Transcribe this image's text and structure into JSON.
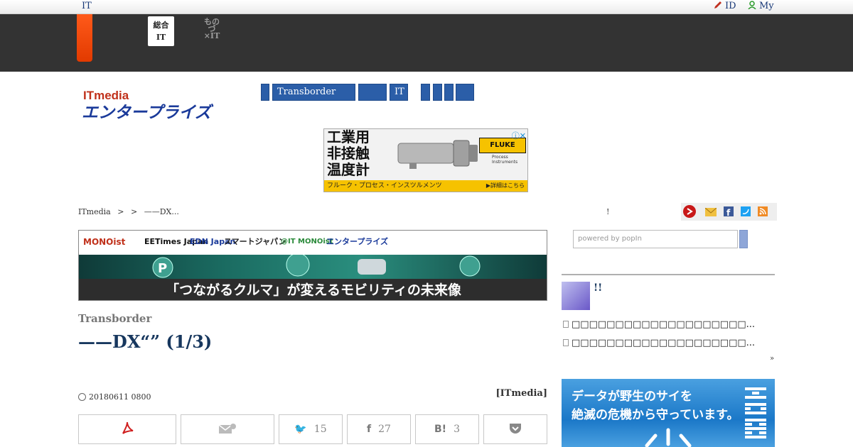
{
  "topbar": {
    "brand": "IT",
    "id_link": "ID",
    "my_link": "My"
  },
  "site_tabs": [
    {
      "line1": "総合",
      "line2": "IT"
    },
    {
      "line1": "ものづ",
      "line2": "×IT"
    }
  ],
  "logo": {
    "top": "ITmedia",
    "bottom": "エンタープライズ"
  },
  "nav": [
    "",
    "Transborder",
    "",
    "IT",
    "",
    "",
    "",
    ""
  ],
  "ad_top": {
    "heading_lines": [
      "工業用",
      "非接触",
      "温度計"
    ],
    "brand": "FLUKE",
    "brand_sub": [
      "Process",
      "Instruments"
    ],
    "strip": "フルーク・プロセス・インスツルメンツ",
    "more": "▶詳細はこちら",
    "adchoice": "ⓘ✕"
  },
  "breadcrumb": [
    "ITmedia",
    ">",
    ">",
    "——DX..."
  ],
  "banner": {
    "publications": [
      "MONOist",
      "EETimes Japan",
      "EDN Japan",
      "スマートジャパン",
      "@IT MONOist",
      "エンタープライズ"
    ],
    "caption": "「つながるクルマ」が変えるモビリティの未来像"
  },
  "article": {
    "series": "Transborder",
    "title": "——DX“” (1/3)",
    "date": "20180611 0800",
    "source": "[ITmedia]"
  },
  "share": {
    "pdf_icon": "pdf-icon",
    "mail_icon": "mail-icon",
    "twitter_count": "15",
    "facebook_count": "27",
    "hatena_count": "3",
    "pocket_icon": "pocket-icon"
  },
  "sidebar": {
    "title": "!",
    "search_placeholder": "powered by popIn",
    "heading": "!!",
    "items": [
      "□□□□□□□□□□□□□□□□□□□□...",
      "□□□□□□□□□□□□□□□□□□□□..."
    ],
    "more": "»",
    "ad_lines": [
      "データが野生のサイを",
      "絶滅の危機から守っています。"
    ]
  }
}
